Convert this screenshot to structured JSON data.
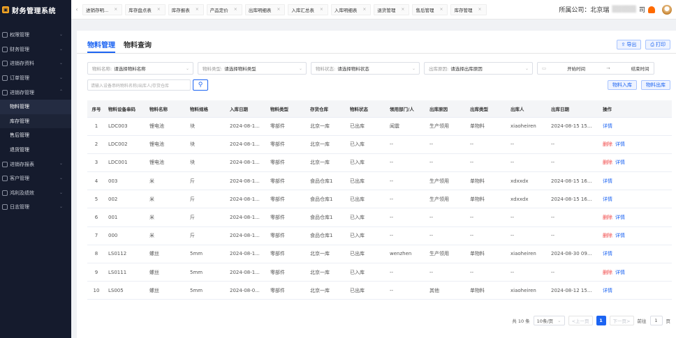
{
  "app": {
    "title": "财务管理系统",
    "logo_glyph": "▣"
  },
  "sidebar": {
    "items": [
      {
        "label": "权限管理",
        "expanded": false
      },
      {
        "label": "财务管理",
        "expanded": false
      },
      {
        "label": "进销存资料",
        "expanded": false
      },
      {
        "label": "订单管理",
        "expanded": false
      },
      {
        "label": "进销存管理",
        "expanded": true
      }
    ],
    "sub_items": [
      {
        "label": "物料管理",
        "active": true
      },
      {
        "label": "库存管理",
        "active": false
      },
      {
        "label": "售后管理",
        "active": false
      },
      {
        "label": "退货管理",
        "active": false
      }
    ],
    "items_after": [
      {
        "label": "进销存报表"
      },
      {
        "label": "客户管理"
      },
      {
        "label": "鸿利及绩效"
      },
      {
        "label": "日志管理"
      }
    ]
  },
  "topbar": {
    "tabs": [
      "进销存明...",
      "库存盘点表",
      "库存报表",
      "产品定价",
      "出库明细表",
      "入库汇总表",
      "入库明细表",
      "退货管理",
      "售后管理",
      "库存管理"
    ],
    "company_label": "所属公司：北京瑞",
    "company_suffix": "司"
  },
  "page": {
    "tabs": [
      {
        "label": "物料管理",
        "active": true
      },
      {
        "label": "物料查询",
        "active": false
      }
    ],
    "export_label": "导出",
    "print_label": "打印",
    "filters": [
      {
        "label": "物料名称:",
        "placeholder": "请选择物料名称",
        "width": 152
      },
      {
        "label": "物料类型:",
        "placeholder": "请选择物料类型",
        "width": 156
      },
      {
        "label": "物料状态:",
        "placeholder": "请选择物料状态",
        "width": 156
      },
      {
        "label": "出库原因:",
        "placeholder": "请选择出库原因",
        "width": 156
      }
    ],
    "date": {
      "start": "开始时间",
      "sep": "→",
      "end": "结束时间"
    },
    "search_placeholder": "请输入设备串码物料名称/出库人/存货仓库",
    "stock_in_label": "物料入库",
    "stock_out_label": "物料出库"
  },
  "table": {
    "columns": [
      "序号",
      "物料设备串码",
      "物料名称",
      "物料规格",
      "入库日期",
      "物料类型",
      "存货仓库",
      "物料状态",
      "领用部门/人",
      "出库原因",
      "出库类型",
      "出库人",
      "出库日期",
      "操作"
    ],
    "rows": [
      [
        "1",
        "LDC003",
        "锂电池",
        "块",
        "2024-08-1...",
        "零部件",
        "北京一库",
        "已出库",
        "闻震",
        "生产领用",
        "单物料",
        "xiaoheiren",
        "2024-08-15 15..."
      ],
      [
        "2",
        "LDC002",
        "锂电池",
        "块",
        "2024-08-1...",
        "零部件",
        "北京一库",
        "已入库",
        "--",
        "--",
        "--",
        "--",
        "--"
      ],
      [
        "3",
        "LDC001",
        "锂电池",
        "块",
        "2024-08-1...",
        "零部件",
        "北京一库",
        "已入库",
        "--",
        "--",
        "--",
        "--",
        "--"
      ],
      [
        "4",
        "003",
        "米",
        "斤",
        "2024-08-1...",
        "零部件",
        "食品仓库1",
        "已出库",
        "--",
        "生产领用",
        "单物料",
        "xdxxdx",
        "2024-08-15 16..."
      ],
      [
        "5",
        "002",
        "米",
        "斤",
        "2024-08-1...",
        "零部件",
        "食品仓库1",
        "已出库",
        "--",
        "生产领用",
        "单物料",
        "xdxxdx",
        "2024-08-15 16..."
      ],
      [
        "6",
        "001",
        "米",
        "斤",
        "2024-08-1...",
        "零部件",
        "食品仓库1",
        "已入库",
        "--",
        "--",
        "--",
        "--",
        "--"
      ],
      [
        "7",
        "000",
        "米",
        "斤",
        "2024-08-1...",
        "零部件",
        "食品仓库1",
        "已入库",
        "--",
        "--",
        "--",
        "--",
        "--"
      ],
      [
        "8",
        "LS0112",
        "螺丝",
        "5mm",
        "2024-08-1...",
        "零部件",
        "北京一库",
        "已出库",
        "wenzhen",
        "生产领用",
        "单物料",
        "xiaoheiren",
        "2024-08-30 09..."
      ],
      [
        "9",
        "LS0111",
        "螺丝",
        "5mm",
        "2024-08-1...",
        "零部件",
        "北京一库",
        "已入库",
        "--",
        "--",
        "--",
        "--",
        "--"
      ],
      [
        "10",
        "LS005",
        "螺丝",
        "5mm",
        "2024-08-0...",
        "零部件",
        "北京一库",
        "已出库",
        "--",
        "其他",
        "单物料",
        "xiaoheiren",
        "2024-08-12 15..."
      ]
    ],
    "ops": [
      [
        "详情"
      ],
      [
        "删除",
        "详情"
      ],
      [
        "删除",
        "详情"
      ],
      [
        "详情"
      ],
      [
        "详情"
      ],
      [
        "删除",
        "详情"
      ],
      [
        "删除",
        "详情"
      ],
      [
        "详情"
      ],
      [
        "删除",
        "详情"
      ],
      [
        "详情"
      ]
    ]
  },
  "pagination": {
    "total": "共 10 条",
    "page_size": "10条/页",
    "prev": "<上一页",
    "current": "1",
    "next": "下一页>",
    "goto_label": "前往",
    "goto_value": "1",
    "page_unit": "页"
  },
  "colors": {
    "accent": "#1c64f2",
    "danger": "#f04444",
    "sidebar": "#151b2d"
  }
}
